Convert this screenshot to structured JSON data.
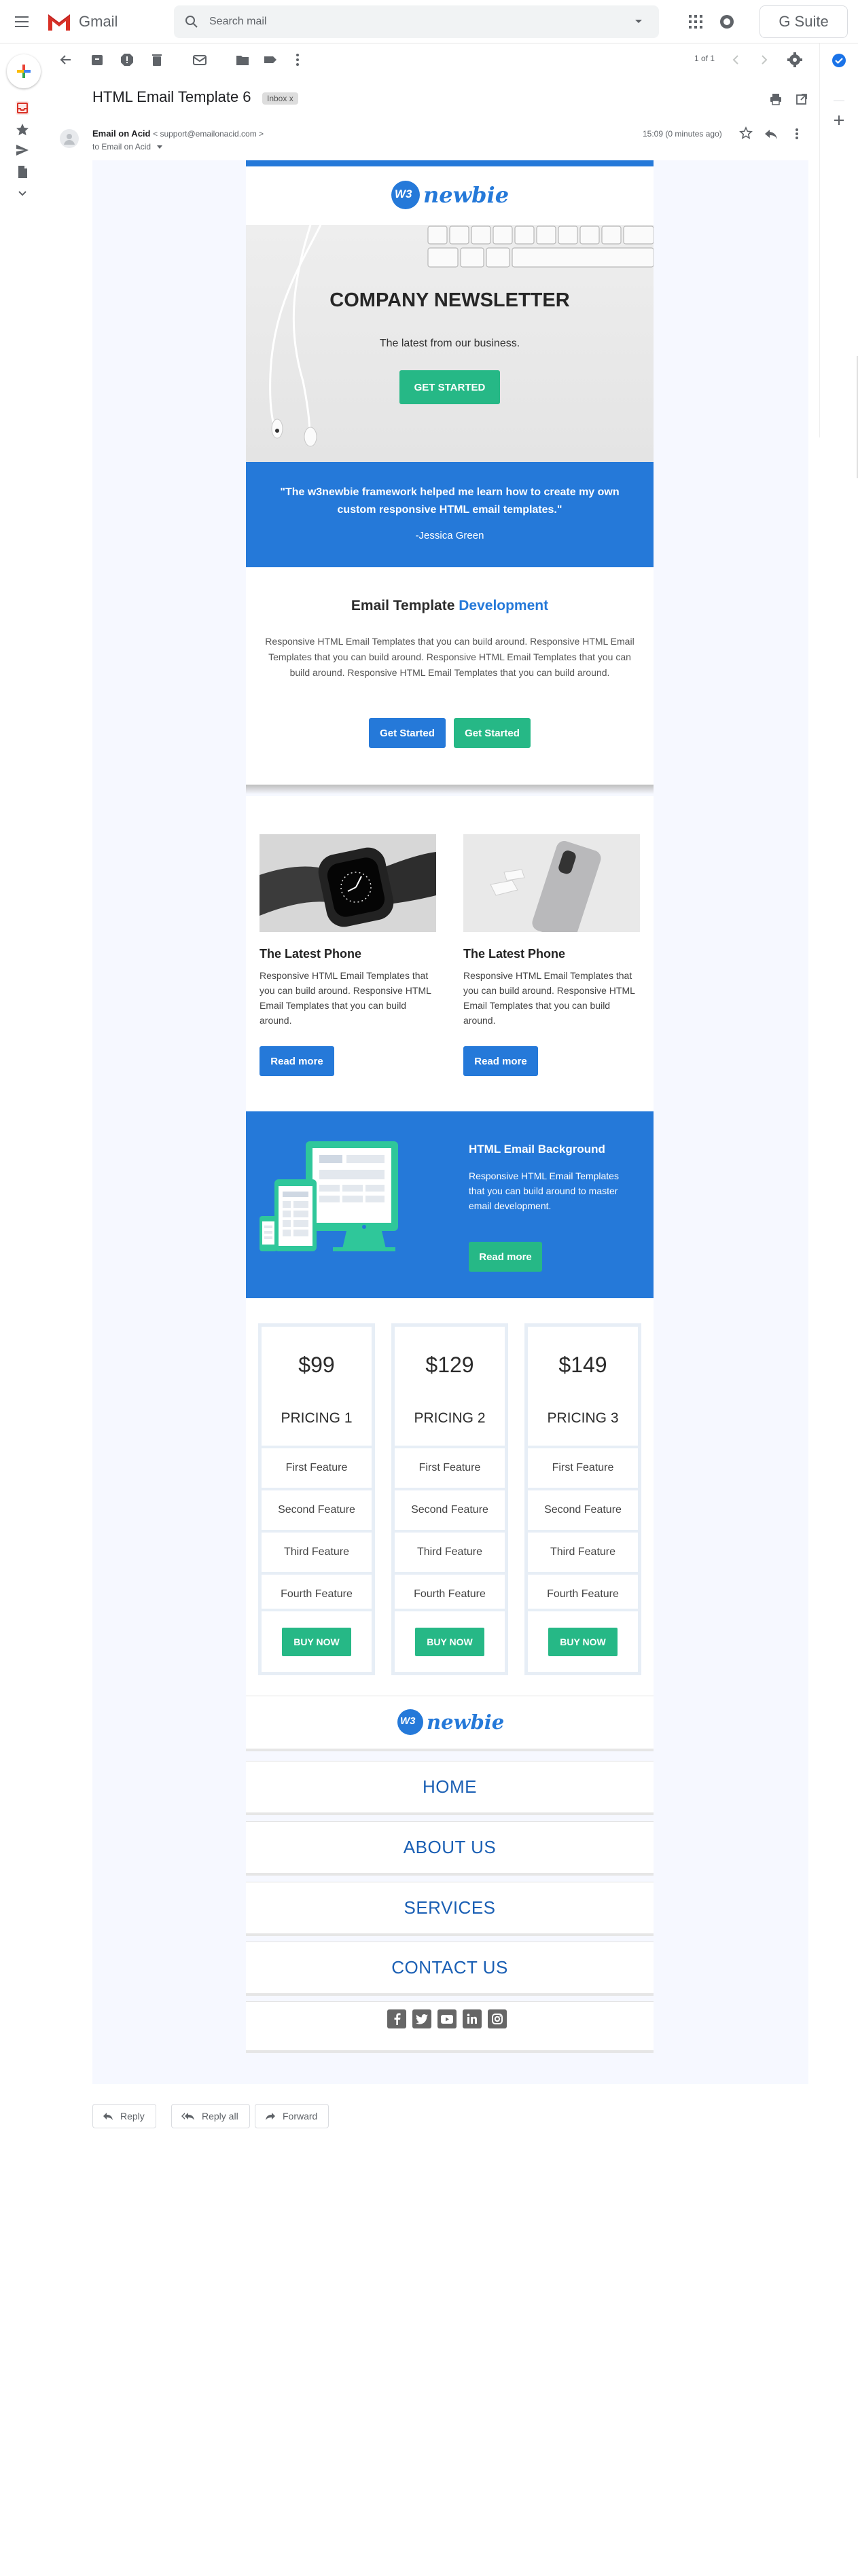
{
  "app": {
    "name": "Gmail",
    "search_placeholder": "Search mail",
    "suite": "G Suite"
  },
  "toolbar": {
    "pagination": "1 of 1"
  },
  "message": {
    "subject": "HTML Email Template 6",
    "label": "Inbox",
    "label_close": "x",
    "sender_name": "Email on Acid",
    "sender_email": "< support@emailonacid.com >",
    "to": "to Email on Acid",
    "time": "15:09 (0 minutes ago)"
  },
  "email": {
    "logo_text": "newbie",
    "logo_mark": "W3",
    "hero_title": "COMPANY NEWSLETTER",
    "hero_sub": "The latest from our business.",
    "hero_cta": "GET STARTED",
    "quote": "\"The w3newbie framework helped me learn how to create my own custom responsive HTML email templates.\"",
    "quote_author": "-Jessica Green",
    "section_title_plain": "Email Template",
    "section_title_accent": "Development",
    "section_body": "Responsive HTML Email Templates that you can build around. Responsive HTML Email Templates that you can build around. Responsive HTML Email Templates that you can build around. Responsive HTML Email Templates that you can build around.",
    "btn_started_1": "Get Started",
    "btn_started_2": "Get Started",
    "products": [
      {
        "title": "The Latest Phone",
        "body": "Responsive HTML Email Templates that you can build around. Responsive HTML Email Templates that you can build around.",
        "btn": "Read more"
      },
      {
        "title": "The Latest Phone",
        "body": "Responsive HTML Email Templates that you can build around. Responsive HTML Email Templates that you can build around.",
        "btn": "Read more"
      }
    ],
    "bg_title": "HTML Email Background",
    "bg_body": "Responsive HTML Email Templates that you can build around to master email development.",
    "bg_btn": "Read more",
    "pricing": [
      {
        "price": "$99",
        "name": "PRICING 1",
        "features": [
          "First Feature",
          "Second Feature",
          "Third Feature",
          "Fourth Feature"
        ],
        "btn": "BUY NOW"
      },
      {
        "price": "$129",
        "name": "PRICING 2",
        "features": [
          "First Feature",
          "Second Feature",
          "Third Feature",
          "Fourth Feature"
        ],
        "btn": "BUY NOW"
      },
      {
        "price": "$149",
        "name": "PRICING 3",
        "features": [
          "First Feature",
          "Second Feature",
          "Third Feature",
          "Fourth Feature"
        ],
        "btn": "BUY NOW"
      }
    ],
    "nav": [
      "HOME",
      "ABOUT US",
      "SERVICES",
      "CONTACT US"
    ],
    "social": [
      "f",
      "t",
      "yt",
      "in",
      "ig"
    ]
  },
  "reply_actions": {
    "reply": "Reply",
    "reply_all": "Reply all",
    "forward": "Forward"
  },
  "colors": {
    "brand_blue": "#2579d9",
    "brand_green": "#26b886",
    "gmail_red": "#d93025"
  }
}
